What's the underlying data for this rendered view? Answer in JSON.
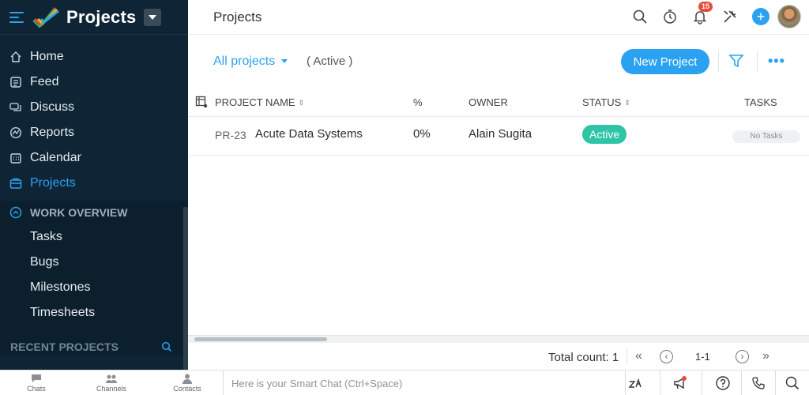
{
  "app": {
    "title": "Projects"
  },
  "sidebar": {
    "items": [
      {
        "label": "Home",
        "icon": "home-icon"
      },
      {
        "label": "Feed",
        "icon": "feed-icon"
      },
      {
        "label": "Discuss",
        "icon": "discuss-icon"
      },
      {
        "label": "Reports",
        "icon": "reports-icon"
      },
      {
        "label": "Calendar",
        "icon": "calendar-icon"
      },
      {
        "label": "Projects",
        "icon": "projects-icon",
        "active": true
      }
    ],
    "work_overview": {
      "label": "WORK OVERVIEW",
      "items": [
        "Tasks",
        "Bugs",
        "Milestones",
        "Timesheets"
      ]
    },
    "recent_projects_label": "RECENT PROJECTS"
  },
  "header": {
    "title": "Projects",
    "notification_count": "15"
  },
  "filters": {
    "view": "All projects",
    "status": "( Active )",
    "new_project_label": "New Project"
  },
  "table": {
    "columns": [
      "PROJECT NAME",
      "%",
      "OWNER",
      "STATUS",
      "TASKS"
    ],
    "rows": [
      {
        "id": "PR-23",
        "name": "Acute Data Systems",
        "percent": "0%",
        "owner": "Alain Sugita",
        "status": "Active",
        "tasks": "No Tasks"
      }
    ]
  },
  "footer": {
    "total_label": "Total count: 1",
    "range": "1-1"
  },
  "bottom_bar": {
    "tabs": [
      "Chats",
      "Channels",
      "Contacts"
    ],
    "chat_placeholder": "Here is your Smart Chat (Ctrl+Space)"
  },
  "colors": {
    "accent": "#2aa2f1",
    "sidebar_bg": "#0f2535",
    "status_active": "#2ec4a6"
  }
}
